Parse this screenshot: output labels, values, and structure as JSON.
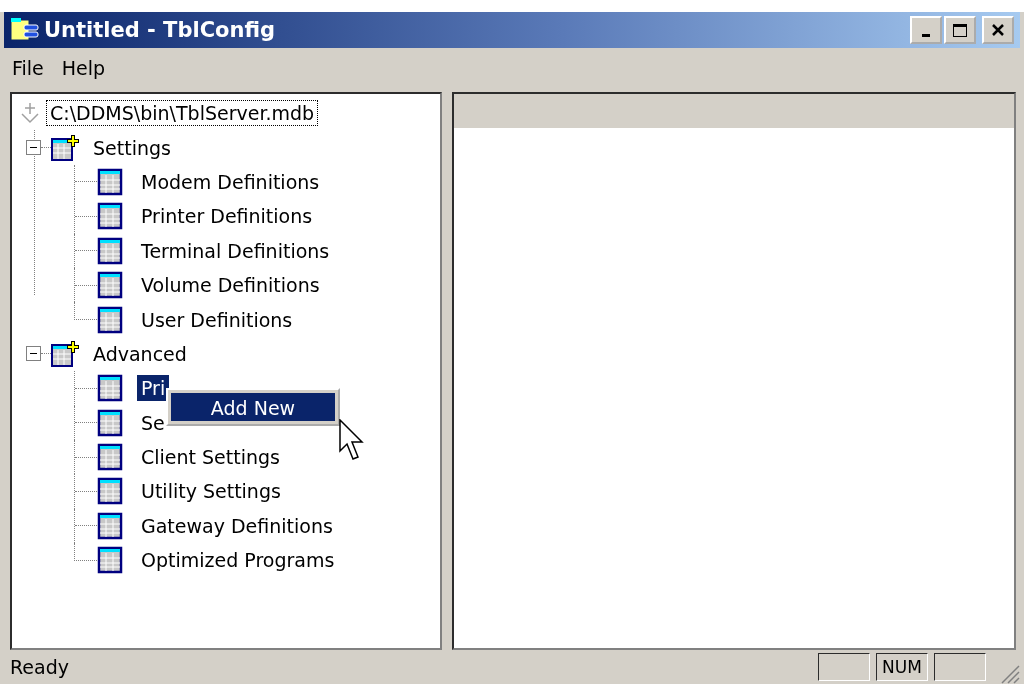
{
  "window": {
    "title": "Untitled - TblConfig"
  },
  "menu": [
    "File",
    "Help"
  ],
  "tree": {
    "root": {
      "label": "C:\\DDMS\\bin\\TblServer.mdb",
      "focused": true
    },
    "groups": [
      {
        "label": "Settings",
        "expanded": true,
        "children": [
          {
            "label": "Modem Definitions",
            "selected": false
          },
          {
            "label": "Printer Definitions",
            "selected": false
          },
          {
            "label": "Terminal Definitions",
            "selected": false
          },
          {
            "label": "Volume Definitions",
            "selected": false
          },
          {
            "label": "User Definitions",
            "selected": false
          }
        ]
      },
      {
        "label": "Advanced",
        "expanded": true,
        "children": [
          {
            "label": "Pri",
            "selected": true
          },
          {
            "label": "Se",
            "selected": false
          },
          {
            "label": "Client Settings",
            "selected": false
          },
          {
            "label": "Utility Settings",
            "selected": false
          },
          {
            "label": "Gateway Definitions",
            "selected": false
          },
          {
            "label": "Optimized Programs",
            "selected": false
          }
        ]
      }
    ]
  },
  "context_menu": {
    "items": [
      {
        "label": "Add New",
        "selected": true
      }
    ]
  },
  "status_bar": {
    "text": "Ready",
    "num_indicator": "NUM"
  }
}
